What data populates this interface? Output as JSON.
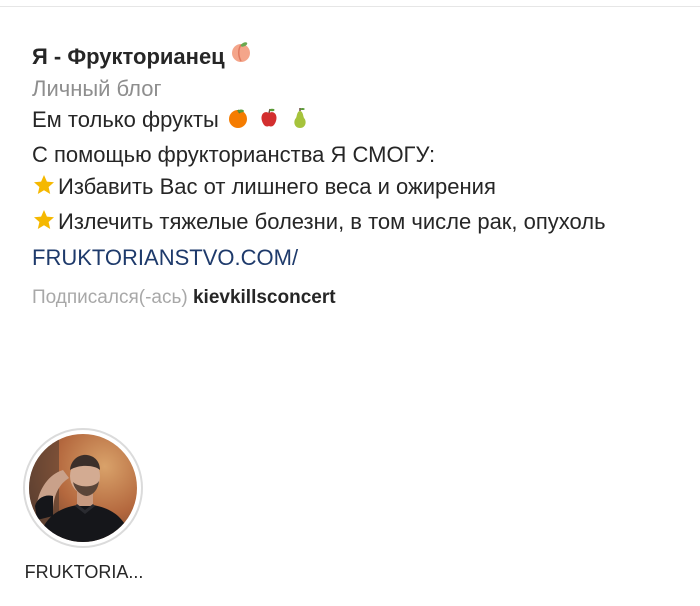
{
  "profile": {
    "name": "Я - Фрукторианец",
    "name_emoji": "peach-emoji",
    "category": "Личный блог",
    "bio_lines": [
      "Ем только фрукты",
      "С помощью фрукторианства Я СМОГУ:",
      "Избавить Вас от лишнего веса и ожирения",
      "Излечить тяжелые болезни, в том числе рак, опухоль"
    ],
    "bio_line1_emojis": [
      "orange-emoji",
      "apple-emoji",
      "pear-emoji"
    ],
    "bullet_icon": "star-icon",
    "link": "FRUKTORIANSTVO.COM/",
    "followed_by_label": "Подписался(-ась)",
    "followed_by_user": "kievkillsconcert"
  },
  "highlights": [
    {
      "label": "FRUKTORIA..."
    }
  ],
  "colors": {
    "text": "#262626",
    "muted": "#8e8e8e",
    "link": "#1e3a6b",
    "divider": "#e6e6e6",
    "ring": "#dbdbdb",
    "star": "#f5b800"
  }
}
